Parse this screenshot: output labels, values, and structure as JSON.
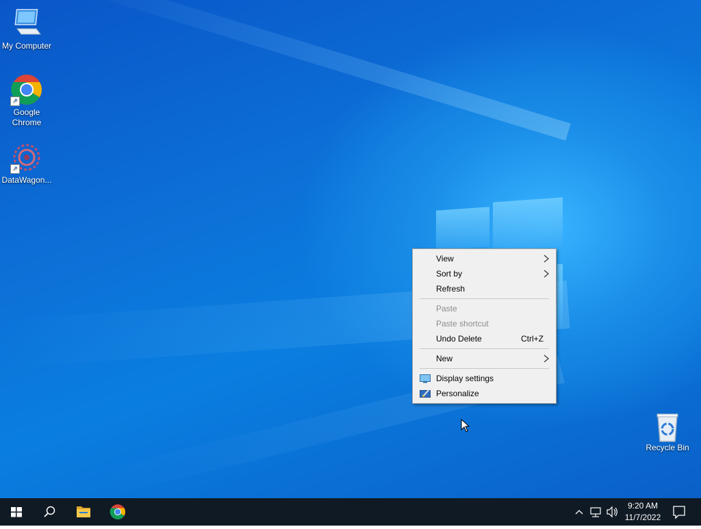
{
  "desktop": {
    "icons": [
      {
        "label": "My Computer",
        "icon": "computer-icon"
      },
      {
        "label": "Google Chrome",
        "icon": "chrome-icon"
      },
      {
        "label": "DataWagon...",
        "icon": "datawagon-icon"
      },
      {
        "label": "Recycle Bin",
        "icon": "recycle-bin-icon"
      }
    ]
  },
  "context_menu": {
    "items": [
      {
        "label": "View",
        "has_submenu": true,
        "enabled": true
      },
      {
        "label": "Sort by",
        "has_submenu": true,
        "enabled": true
      },
      {
        "label": "Refresh",
        "enabled": true
      },
      {
        "label": "Paste",
        "enabled": false
      },
      {
        "label": "Paste shortcut",
        "enabled": false
      },
      {
        "label": "Undo Delete",
        "shortcut": "Ctrl+Z",
        "enabled": true
      },
      {
        "label": "New",
        "has_submenu": true,
        "enabled": true
      },
      {
        "label": "Display settings",
        "icon": "display-settings-icon",
        "enabled": true
      },
      {
        "label": "Personalize",
        "icon": "personalize-icon",
        "enabled": true
      }
    ]
  },
  "taskbar": {
    "pinned": [
      "start-icon",
      "search-icon",
      "file-explorer-icon",
      "chrome-icon"
    ],
    "tray": {
      "time": "9:20 AM",
      "date": "11/7/2022"
    }
  },
  "colors": {
    "taskbar_bg": "#101a24",
    "menu_bg": "#f0f0f0",
    "menu_disabled_text": "#8c8c8c"
  }
}
